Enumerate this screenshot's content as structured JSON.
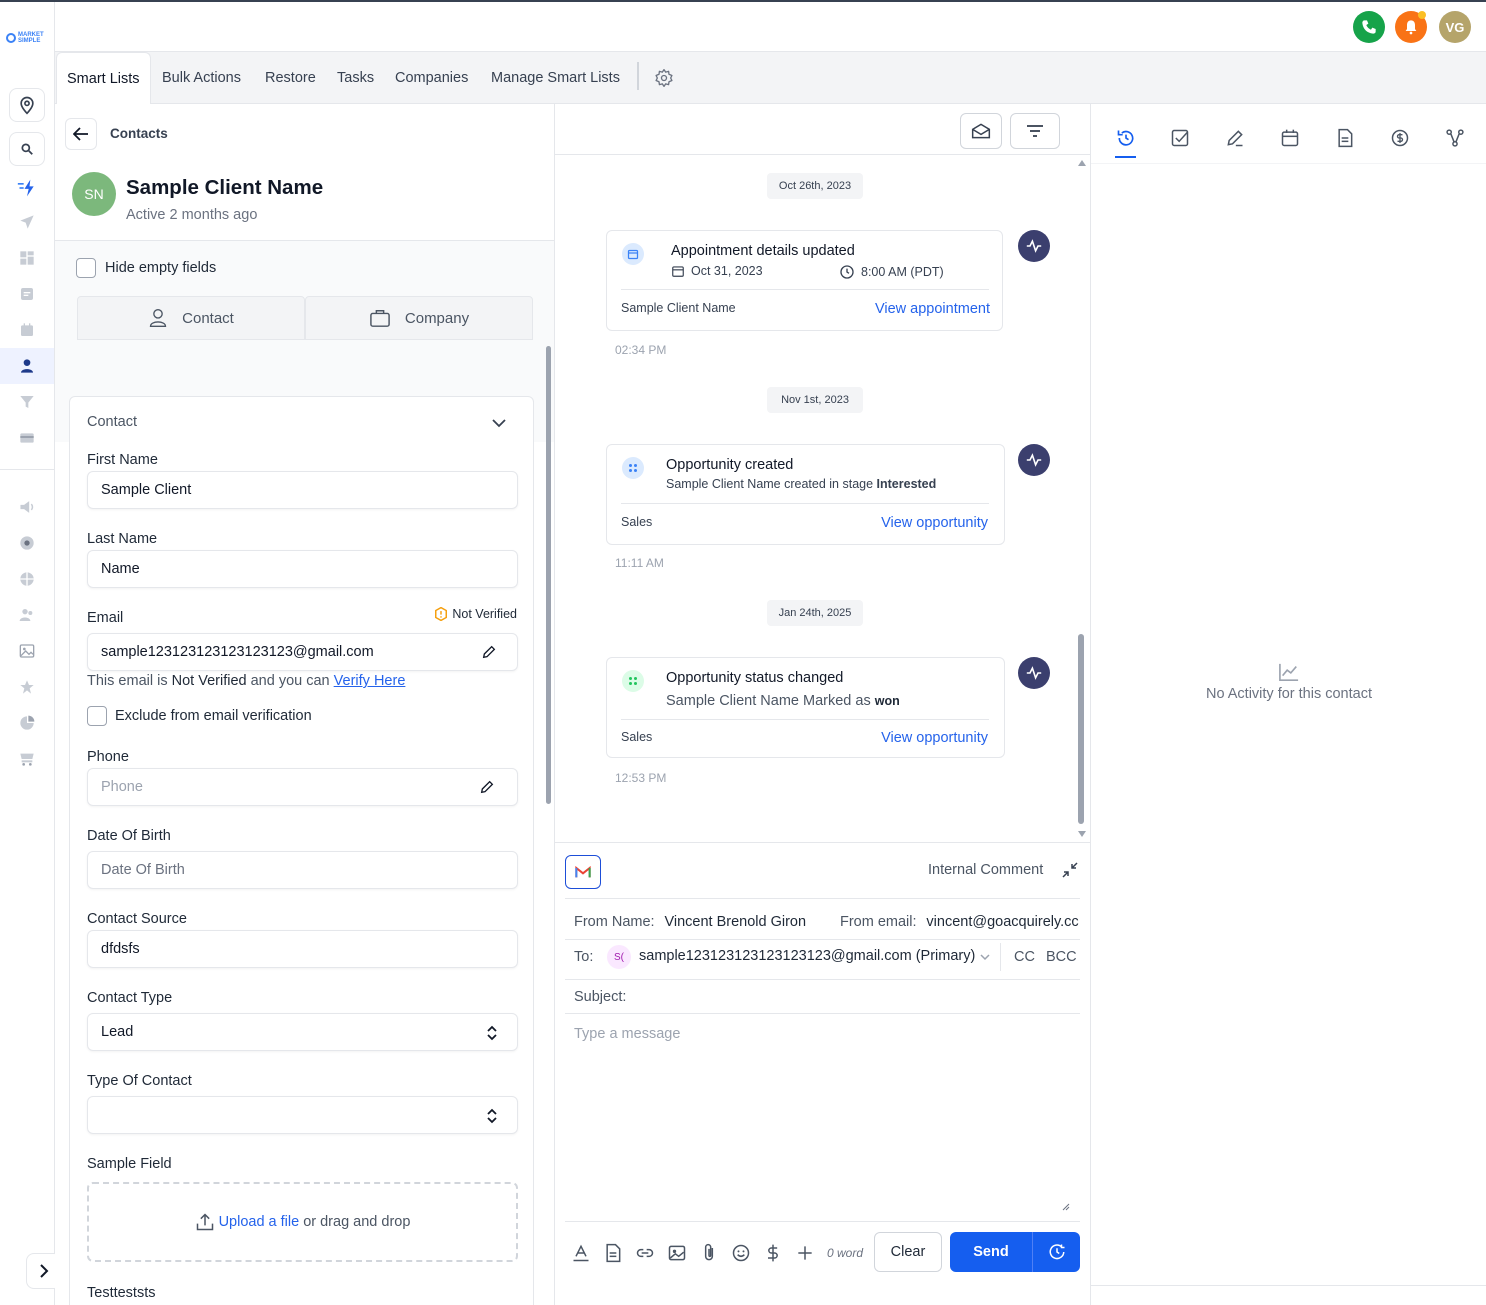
{
  "brand": {
    "logo_text": "MARKETING SIMPLE"
  },
  "header": {
    "user_initials": "VG"
  },
  "tabs": [
    "Smart Lists",
    "Bulk Actions",
    "Restore",
    "Tasks",
    "Companies",
    "Manage Smart Lists"
  ],
  "contact": {
    "breadcrumb": "Contacts",
    "initials": "SN",
    "name": "Sample Client Name",
    "active": "Active 2 months ago",
    "hide_empty": "Hide empty fields",
    "seg_contact": "Contact",
    "seg_company": "Company",
    "section_title": "Contact",
    "fields": {
      "first_name_label": "First Name",
      "first_name": "Sample Client",
      "last_name_label": "Last Name",
      "last_name": "Name",
      "email_label": "Email",
      "email": "sample123123123123123123@gmail.com",
      "not_verified": "Not Verified",
      "hint_1": "This email is ",
      "hint_2": "Not Verified",
      "hint_3": " and you can ",
      "hint_link": "Verify Here",
      "exclude": "Exclude from email verification",
      "phone_label": "Phone",
      "phone_placeholder": "Phone",
      "dob_label": "Date Of Birth",
      "dob_placeholder": "Date Of Birth",
      "source_label": "Contact Source",
      "source": "dfdsfs",
      "type_label": "Contact Type",
      "type": "Lead",
      "type_of_contact_label": "Type Of Contact",
      "type_of_contact": "",
      "sample_field_label": "Sample Field",
      "upload_link": "Upload a file",
      "upload_rest": "or drag and drop",
      "testteststs_label": "Testteststs"
    }
  },
  "timeline": [
    {
      "date": "Oct 26th, 2023",
      "title": "Appointment details updated",
      "appt_date": "Oct 31, 2023",
      "appt_time": "8:00 AM (PDT)",
      "footer": "Sample Client Name",
      "link": "View appointment",
      "time": "02:34 PM"
    },
    {
      "date": "Nov 1st, 2023",
      "title": "Opportunity created",
      "sub_1": "Sample Client Name created in stage ",
      "sub_2": "Interested",
      "footer": "Sales",
      "link": "View opportunity",
      "time": "11:11 AM"
    },
    {
      "date": "Jan 24th, 2025",
      "title": "Opportunity status changed",
      "sub_1": "Sample Client Name Marked as ",
      "sub_2": "won",
      "footer": "Sales",
      "link": "View opportunity",
      "time": "12:53 PM"
    }
  ],
  "composer": {
    "internal_comment": "Internal Comment",
    "from_name_label": "From Name:",
    "from_name": "Vincent Brenold Giron",
    "from_email_label": "From email:",
    "from_email": "vincent@goacquirely.cc",
    "to_label": "To:",
    "to_badge": "S(",
    "to": "sample123123123123123123@gmail.com (Primary)",
    "cc": "CC",
    "bcc": "BCC",
    "subject_label": "Subject:",
    "message_placeholder": "Type a message",
    "word_count": "0 word",
    "clear": "Clear",
    "send": "Send"
  },
  "right_panel": {
    "empty": "No Activity for this contact"
  },
  "colors": {
    "primary": "#155eef",
    "avatar": "#7cb87c",
    "phone": "#16a34a",
    "bell": "#f97316",
    "user": "#b5a46a",
    "pulse": "#3b3f6e"
  }
}
